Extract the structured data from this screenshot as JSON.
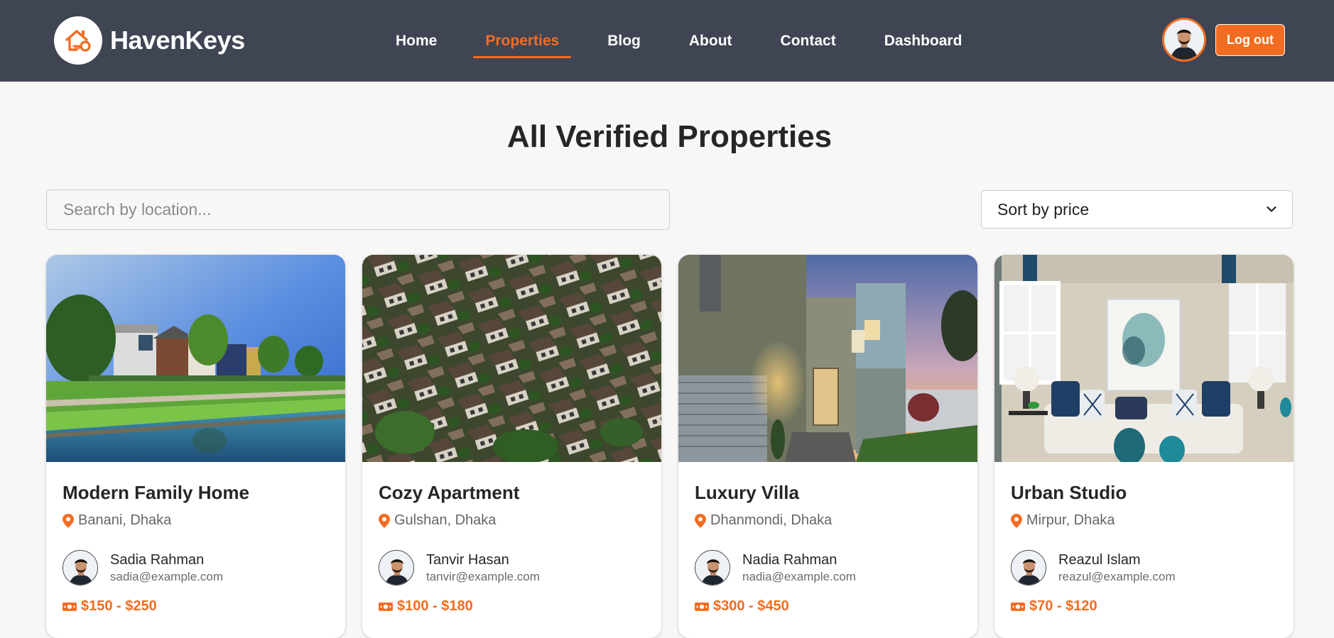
{
  "brand": {
    "name": "HavenKeys",
    "icon": "house-key-icon",
    "accent": "#f26d21",
    "navbar_color": "#404554"
  },
  "nav": {
    "items": [
      {
        "label": "Home"
      },
      {
        "label": "Properties"
      },
      {
        "label": "Blog"
      },
      {
        "label": "About"
      },
      {
        "label": "Contact"
      },
      {
        "label": "Dashboard"
      }
    ],
    "active": "Properties"
  },
  "user": {
    "avatar": "user-avatar",
    "logout_label": "Log out"
  },
  "page": {
    "title": "All Verified Properties",
    "search_placeholder": "Search by location...",
    "sort_label": "Sort by price"
  },
  "properties": [
    {
      "title": "Modern Family Home",
      "location": "Banani, Dhaka",
      "agent_name": "Sadia Rahman",
      "agent_email": "sadia@example.com",
      "price": "$150 - $250",
      "image": "suburban-houses-by-canal"
    },
    {
      "title": "Cozy Apartment",
      "location": "Gulshan, Dhaka",
      "agent_name": "Tanvir Hasan",
      "agent_email": "tanvir@example.com",
      "price": "$100 - $180",
      "image": "aerial-rooftops-neighborhood"
    },
    {
      "title": "Luxury Villa",
      "location": "Dhanmondi, Dhaka",
      "agent_name": "Nadia Rahman",
      "agent_email": "nadia@example.com",
      "price": "$300 - $450",
      "image": "modern-house-at-dusk"
    },
    {
      "title": "Urban Studio",
      "location": "Mirpur, Dhaka",
      "agent_name": "Reazul Islam",
      "agent_email": "reazul@example.com",
      "price": "$70 - $120",
      "image": "living-room-interior"
    }
  ]
}
